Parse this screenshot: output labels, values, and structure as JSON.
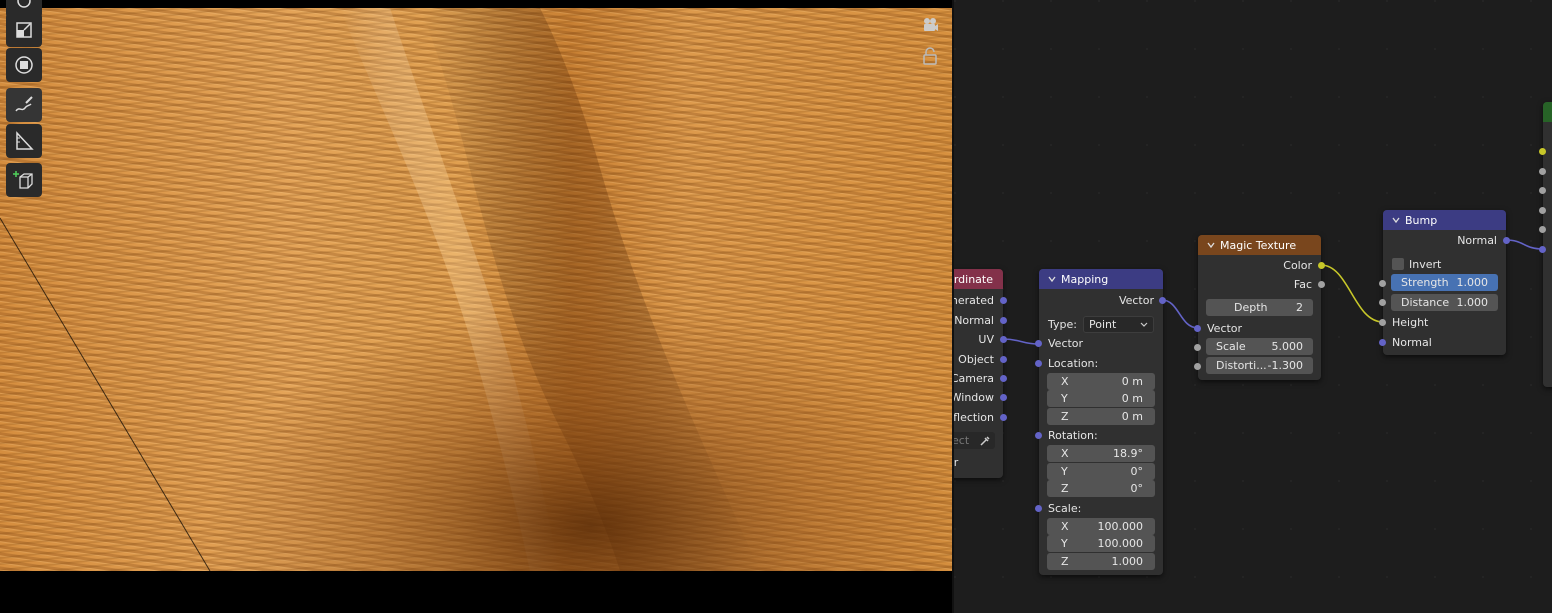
{
  "viewport": {
    "tools": [
      "rotate-tool",
      "scale-tool",
      "transform-tool",
      "annotate-tool",
      "measure-tool",
      "add-cube-tool"
    ]
  },
  "nodes": {
    "texcoord": {
      "title": "ordinate",
      "outputs": [
        "enerated",
        "Normal",
        "UV",
        "Object",
        "Camera",
        "Window",
        "eflection"
      ],
      "object_placeholder": "bject",
      "instancer": "ncer"
    },
    "mapping": {
      "title": "Mapping",
      "out_vector": "Vector",
      "type_label": "Type:",
      "type_value": "Point",
      "in_vector": "Vector",
      "location_label": "Location:",
      "location": [
        {
          "axis": "X",
          "value": "0 m"
        },
        {
          "axis": "Y",
          "value": "0 m"
        },
        {
          "axis": "Z",
          "value": "0 m"
        }
      ],
      "rotation_label": "Rotation:",
      "rotation": [
        {
          "axis": "X",
          "value": "18.9°"
        },
        {
          "axis": "Y",
          "value": "0°"
        },
        {
          "axis": "Z",
          "value": "0°"
        }
      ],
      "scale_label": "Scale:",
      "scale": [
        {
          "axis": "X",
          "value": "100.000"
        },
        {
          "axis": "Y",
          "value": "100.000"
        },
        {
          "axis": "Z",
          "value": "1.000"
        }
      ]
    },
    "magic": {
      "title": "Magic Texture",
      "out_color": "Color",
      "out_fac": "Fac",
      "depth_label": "Depth",
      "depth_value": "2",
      "in_vector": "Vector",
      "scale_label": "Scale",
      "scale_value": "5.000",
      "distortion_label": "Distorti...",
      "distortion_value": "-1.300"
    },
    "bump": {
      "title": "Bump",
      "out_normal": "Normal",
      "invert_label": "Invert",
      "strength_label": "Strength",
      "strength_value": "1.000",
      "distance_label": "Distance",
      "distance_value": "1.000",
      "in_height": "Height",
      "in_normal": "Normal"
    }
  },
  "colors": {
    "texcoord_header": "#83314a",
    "mapping_header": "#3c3c83",
    "magic_header": "#79461d",
    "bump_header": "#3c3c83",
    "shader_header": "#276327"
  }
}
